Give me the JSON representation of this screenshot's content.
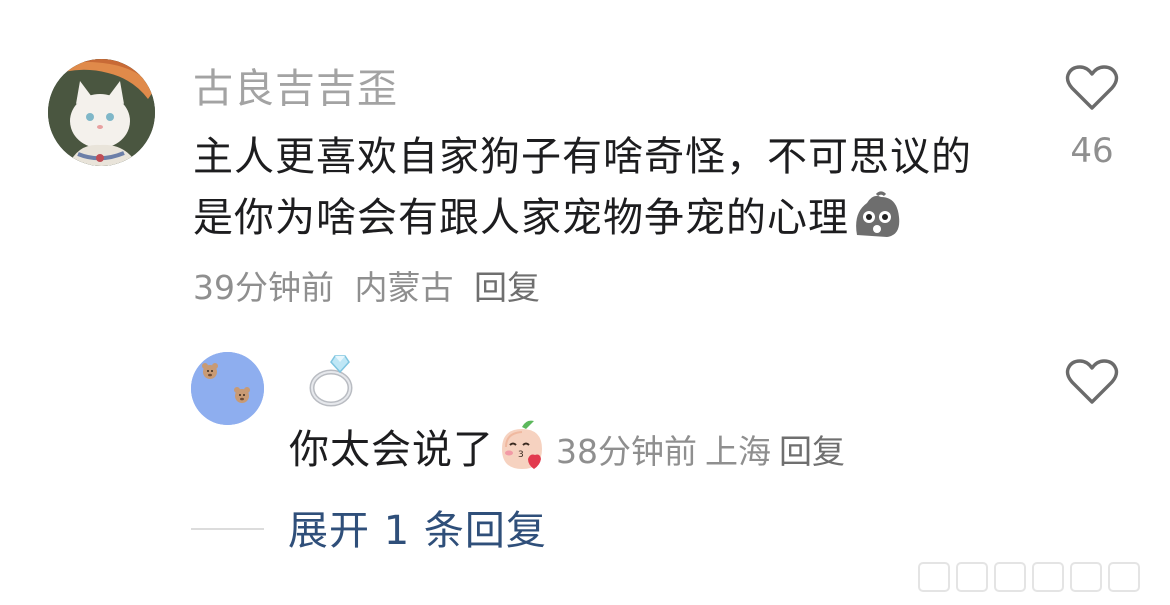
{
  "comment": {
    "username": "古良吉吉歪",
    "text_lines": [
      "主人更喜欢自家狗子有啥奇怪，不可思议的",
      "是你为啥会有跟人家宠物争宠的心理"
    ],
    "time": "39分钟前",
    "location": "内蒙古",
    "reply_label": "回复",
    "like_count": "46",
    "avatar_icon": "cat-avatar-icon",
    "emoji_icon": "shocked-blob-emoji"
  },
  "reply": {
    "username_icon": "ring-emoji",
    "text": "你太会说了",
    "emoji_icon": "blowing-kiss-peach-emoji",
    "time": "38分钟前",
    "location": "上海",
    "reply_label": "回复",
    "avatar_icon": "bear-faces-avatar-icon",
    "avatar_color": "#8eaeef"
  },
  "expand_replies_label": "展开 1 条回复",
  "colors": {
    "username": "#a3a3a3",
    "text": "#1d1d1f",
    "meta": "#8f8f8f",
    "link": "#2f4f7a"
  }
}
